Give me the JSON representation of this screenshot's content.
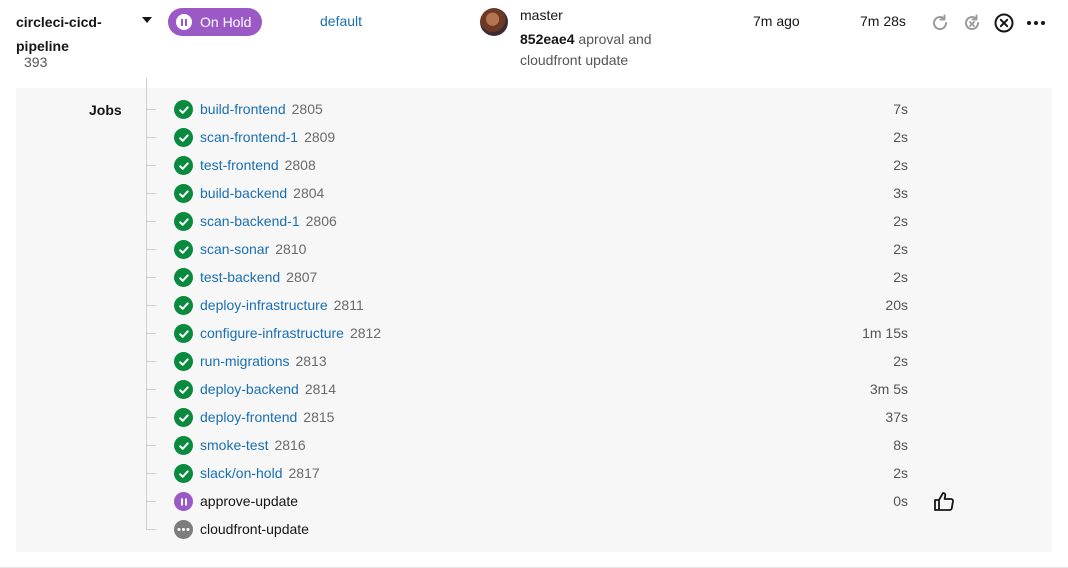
{
  "pipeline": {
    "name": "circleci-cicd-pipeline",
    "number": "393",
    "status": "On Hold",
    "branch": "default",
    "commit_branch": "master",
    "commit_hash": "852eae4",
    "commit_message": "aproval and cloudfront update",
    "time_ago": "7m ago",
    "duration": "7m 28s"
  },
  "colors": {
    "hold": "#9b59c5",
    "success": "#0a8a3e",
    "link": "#1a6fb3",
    "queued": "#7d7d7d"
  },
  "jobs": {
    "label": "Jobs",
    "items": [
      {
        "name": "build-frontend",
        "number": "2805",
        "duration": "7s",
        "status": "success"
      },
      {
        "name": "scan-frontend-1",
        "number": "2809",
        "duration": "2s",
        "status": "success"
      },
      {
        "name": "test-frontend",
        "number": "2808",
        "duration": "2s",
        "status": "success"
      },
      {
        "name": "build-backend",
        "number": "2804",
        "duration": "3s",
        "status": "success"
      },
      {
        "name": "scan-backend-1",
        "number": "2806",
        "duration": "2s",
        "status": "success"
      },
      {
        "name": "scan-sonar",
        "number": "2810",
        "duration": "2s",
        "status": "success"
      },
      {
        "name": "test-backend",
        "number": "2807",
        "duration": "2s",
        "status": "success"
      },
      {
        "name": "deploy-infrastructure",
        "number": "2811",
        "duration": "20s",
        "status": "success"
      },
      {
        "name": "configure-infrastructure",
        "number": "2812",
        "duration": "1m 15s",
        "status": "success"
      },
      {
        "name": "run-migrations",
        "number": "2813",
        "duration": "2s",
        "status": "success"
      },
      {
        "name": "deploy-backend",
        "number": "2814",
        "duration": "3m 5s",
        "status": "success"
      },
      {
        "name": "deploy-frontend",
        "number": "2815",
        "duration": "37s",
        "status": "success"
      },
      {
        "name": "smoke-test",
        "number": "2816",
        "duration": "8s",
        "status": "success"
      },
      {
        "name": "slack/on-hold",
        "number": "2817",
        "duration": "2s",
        "status": "success"
      },
      {
        "name": "approve-update",
        "number": "",
        "duration": "0s",
        "status": "hold"
      },
      {
        "name": "cloudfront-update",
        "number": "",
        "duration": "",
        "status": "queued"
      }
    ]
  }
}
